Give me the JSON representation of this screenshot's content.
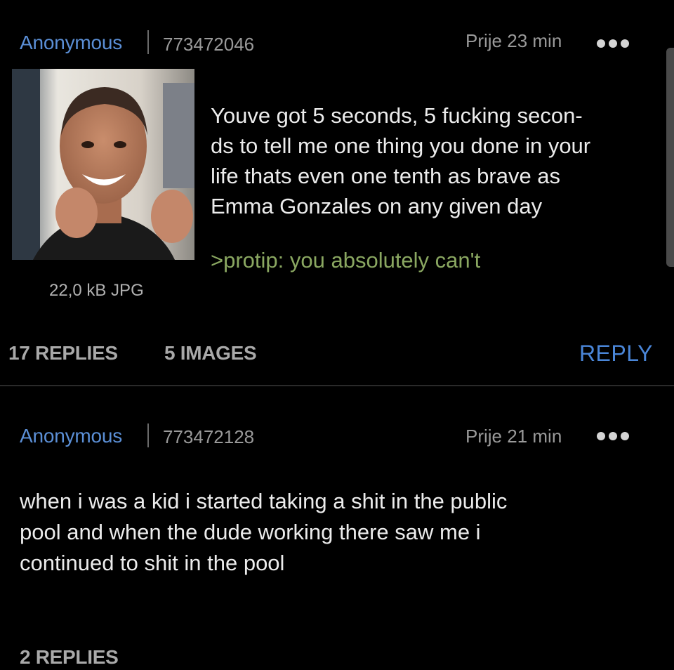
{
  "colors": {
    "background": "#000000",
    "name": "#5b8fd6",
    "greentext": "#8aa761",
    "reply_button": "#4a86d8",
    "muted": "#9a9a9a"
  },
  "posts": [
    {
      "name": "Anonymous",
      "post_number": "773472046",
      "time": "Prije 23 min",
      "thumbnail_icon": "photo-thumbnail",
      "file_info": "22,0 kB JPG",
      "text_lines": [
        "Youve got 5 seconds, 5 fucking secon-",
        "ds to tell me one thing you done in your",
        "life thats even one tenth as brave as",
        "Emma Gonzales on any given day"
      ],
      "greentext": ">protip: you absolutely can't",
      "replies": "17 REPLIES",
      "images": "5 IMAGES",
      "reply_button": "REPLY"
    },
    {
      "name": "Anonymous",
      "post_number": "773472128",
      "time": "Prije 21 min",
      "text_lines": [
        "when i was a kid i started taking a shit in the public",
        "pool and when the dude working there saw me i",
        "continued to shit in the pool"
      ],
      "replies": "2 REPLIES"
    }
  ]
}
